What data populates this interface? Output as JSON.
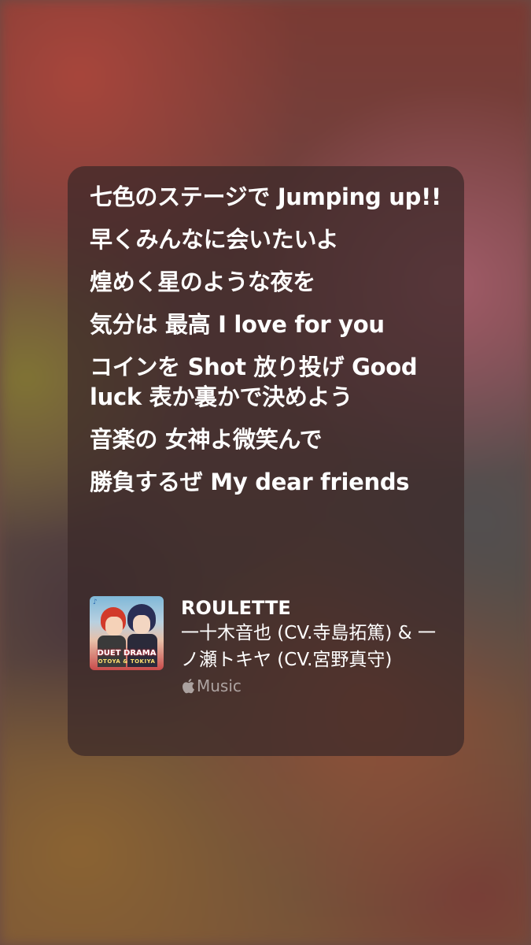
{
  "lyrics": [
    "七色のステージで Jumping up!!",
    "早くみんなに会いたいよ",
    "煌めく星のような夜を",
    "気分は 最高 I love for you",
    "コインを Shot 放り投げ Good luck 表か裏かで決めよう",
    "音楽の 女神よ微笑んで",
    "勝負するぜ My dear friends"
  ],
  "track": {
    "title": "ROULETTE",
    "artist": "一十木音也 (CV.寺島拓篤) & 一ノ瀬トキヤ (CV.宮野真守)",
    "artwork_title": "DUET DRAMA",
    "artwork_subtitle": "OTOYA & TOKIYA",
    "service_label": "Music"
  },
  "icons": {
    "service_icon": "apple-logo-icon"
  }
}
